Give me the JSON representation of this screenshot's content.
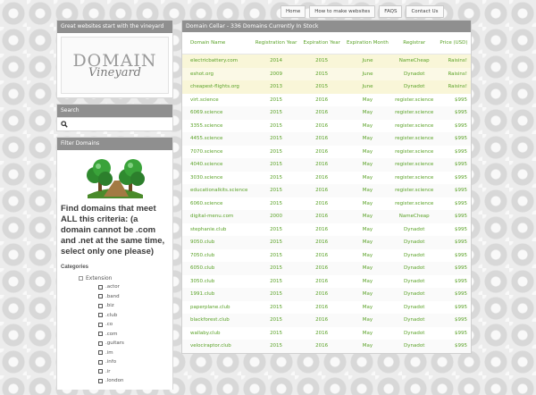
{
  "nav": [
    "Home",
    "How to make websites",
    "FAQS",
    "Contact Us"
  ],
  "tagline": "Great websites start with the vineyard",
  "logo": {
    "top": "DOMAIN",
    "bottom": "Vineyard"
  },
  "search": {
    "title": "Search",
    "icon": "search-icon"
  },
  "filter": {
    "title": "Filter Domains",
    "note": "Find domains that meet ALL this criteria: (a domain cannot be .com and .net at the same time, select only one please)",
    "categories_label": "Categories",
    "group_label": "Extension",
    "extensions": [
      ".actor",
      ".band",
      ".biz",
      ".club",
      ".co",
      ".com",
      ".guitars",
      ".im",
      ".info",
      ".ir",
      ".london"
    ]
  },
  "main": {
    "title": "Domain Cellar - 336 Domains Currently In Stock",
    "columns": [
      "Domain Name",
      "Registration Year",
      "Expiration Year",
      "Expiration Month",
      "Registrar",
      "Price (USD)"
    ],
    "rows": [
      [
        "electricbattery.com",
        "2014",
        "2015",
        "June",
        "NameCheap",
        "Raisins!"
      ],
      [
        "eshot.org",
        "2009",
        "2015",
        "June",
        "Dynadot",
        "Raisins!"
      ],
      [
        "cheapest-flights.org",
        "2013",
        "2015",
        "June",
        "Dynadot",
        "Raisins!"
      ],
      [
        "virt.science",
        "2015",
        "2016",
        "May",
        "register.science",
        "$995"
      ],
      [
        "6069.science",
        "2015",
        "2016",
        "May",
        "register.science",
        "$995"
      ],
      [
        "3355.science",
        "2015",
        "2016",
        "May",
        "register.science",
        "$995"
      ],
      [
        "4455.science",
        "2015",
        "2016",
        "May",
        "register.science",
        "$995"
      ],
      [
        "7070.science",
        "2015",
        "2016",
        "May",
        "register.science",
        "$995"
      ],
      [
        "4040.science",
        "2015",
        "2016",
        "May",
        "register.science",
        "$995"
      ],
      [
        "3030.science",
        "2015",
        "2016",
        "May",
        "register.science",
        "$995"
      ],
      [
        "educationalkits.science",
        "2015",
        "2016",
        "May",
        "register.science",
        "$995"
      ],
      [
        "6060.science",
        "2015",
        "2016",
        "May",
        "register.science",
        "$995"
      ],
      [
        "digital-menu.com",
        "2000",
        "2016",
        "May",
        "NameCheap",
        "$995"
      ],
      [
        "stephanie.club",
        "2015",
        "2016",
        "May",
        "Dynadot",
        "$995"
      ],
      [
        "9050.club",
        "2015",
        "2016",
        "May",
        "Dynadot",
        "$995"
      ],
      [
        "7050.club",
        "2015",
        "2016",
        "May",
        "Dynadot",
        "$995"
      ],
      [
        "6050.club",
        "2015",
        "2016",
        "May",
        "Dynadot",
        "$995"
      ],
      [
        "3050.club",
        "2015",
        "2016",
        "May",
        "Dynadot",
        "$995"
      ],
      [
        "1991.club",
        "2015",
        "2016",
        "May",
        "Dynadot",
        "$995"
      ],
      [
        "paperplane.club",
        "2015",
        "2016",
        "May",
        "Dynadot",
        "$995"
      ],
      [
        "blackforest.club",
        "2015",
        "2016",
        "May",
        "Dynadot",
        "$995"
      ],
      [
        "wallaby.club",
        "2015",
        "2016",
        "May",
        "Dynadot",
        "$995"
      ],
      [
        "velociraptor.club",
        "2015",
        "2016",
        "May",
        "Dynadot",
        "$995"
      ]
    ]
  },
  "colors": {
    "accent": "#5aa227",
    "header_bg": "#8f8f8f"
  }
}
